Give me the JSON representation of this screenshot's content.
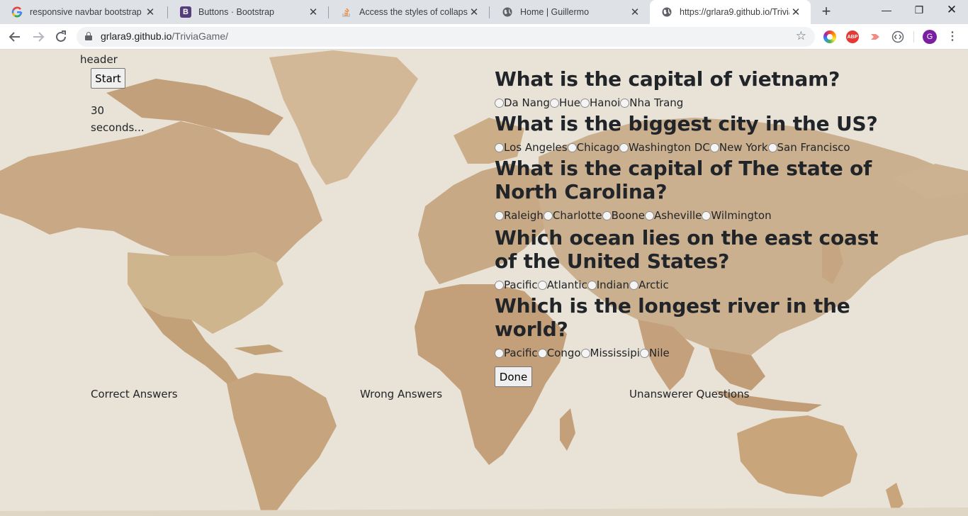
{
  "browser": {
    "tabs": [
      {
        "title": "responsive navbar bootstrap -",
        "favicon": "google-icon",
        "active": false
      },
      {
        "title": "Buttons · Bootstrap",
        "favicon": "bootstrap-icon",
        "active": false
      },
      {
        "title": "Access the styles of collapsed c",
        "favicon": "stackoverflow-icon",
        "active": false
      },
      {
        "title": "Home | Guillermo",
        "favicon": "globe-icon",
        "active": false
      },
      {
        "title": "https://grlara9.github.io/TriviaG",
        "favicon": "globe-icon",
        "active": true
      }
    ],
    "address": {
      "host": "grlara9.github.io",
      "path": "/TriviaGame/"
    },
    "extensions": {
      "abp_label": "ABP"
    },
    "profile_initial": "G"
  },
  "page": {
    "header": "header",
    "start_label": "Start",
    "timer": "30 seconds...",
    "questions": [
      {
        "question": "What is the capital of vietnam?",
        "options": [
          "Da Nang",
          "Hue",
          "Hanoi",
          "Nha Trang"
        ]
      },
      {
        "question": "What is the biggest city in the US?",
        "options": [
          "Los Angeles",
          "Chicago",
          "Washington DC",
          "New York",
          "San Francisco"
        ]
      },
      {
        "question": "What is the capital of The state of North Carolina?",
        "options": [
          "Raleigh",
          "Charlotte",
          "Boone",
          "Asheville",
          "Wilmington"
        ]
      },
      {
        "question": "Which ocean lies on the east coast of the United States?",
        "options": [
          "Pacific",
          "Atlantic",
          "Indian",
          "Arctic"
        ]
      },
      {
        "question": "Which is the longest river in the world?",
        "options": [
          "Pacific",
          "Congo",
          "Mississipi",
          "Nile"
        ]
      }
    ],
    "done_label": "Done",
    "stats": {
      "correct": "Correct Answers",
      "wrong": "Wrong Answers",
      "unanswered": "Unanswerer Questions"
    }
  },
  "colors": {
    "tabstrip": "#dee1e6",
    "map_ocean": "#e9e2d6",
    "map_land": "#c9ae8c",
    "text": "#212529"
  }
}
